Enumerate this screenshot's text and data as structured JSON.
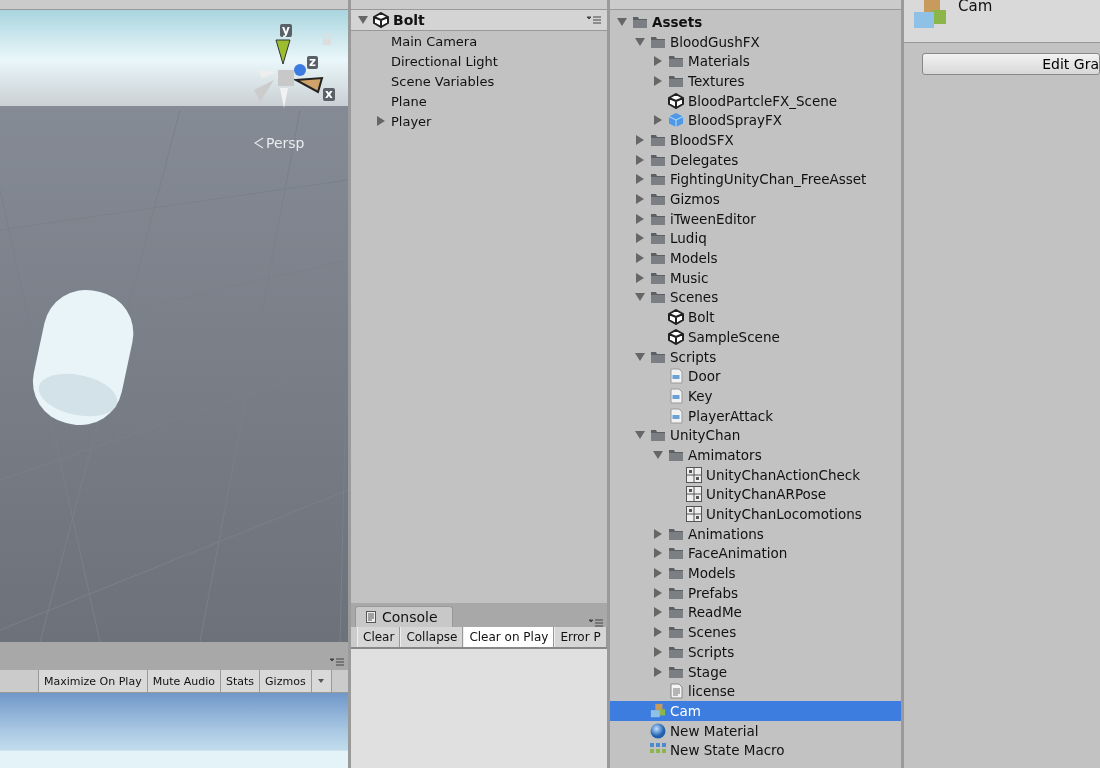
{
  "scene_view": {
    "axes": {
      "y": "y",
      "z": "z",
      "x": "x"
    },
    "projection": "Persp"
  },
  "game_view": {
    "toolbar": [
      {
        "label": "Maximize On Play",
        "selected": false
      },
      {
        "label": "Mute Audio",
        "selected": false
      },
      {
        "label": "Stats",
        "selected": false
      },
      {
        "label": "Gizmos",
        "selected": false
      }
    ]
  },
  "hierarchy": {
    "scene": {
      "label": "Bolt",
      "expanded": true
    },
    "items": [
      {
        "label": "Main Camera"
      },
      {
        "label": "Directional Light"
      },
      {
        "label": "Scene Variables"
      },
      {
        "label": "Plane"
      },
      {
        "label": "Player",
        "expanded": false
      }
    ]
  },
  "console": {
    "tab": "Console",
    "buttons": [
      {
        "label": "Clear",
        "kind": "button"
      },
      {
        "label": "Collapse",
        "kind": "toggle",
        "selected": false
      },
      {
        "label": "Clear on Play",
        "kind": "toggle",
        "selected": true
      },
      {
        "label": "Error P",
        "kind": "toggle",
        "selected": false
      }
    ]
  },
  "project": {
    "items": [
      {
        "label": "Assets",
        "kind": "folder",
        "expanded": true,
        "selected": false,
        "children": [
          {
            "label": "BloodGushFX",
            "kind": "folder",
            "expanded": true,
            "selected": false,
            "children": [
              {
                "label": "Materials",
                "kind": "folder",
                "expanded": false,
                "selected": false
              },
              {
                "label": "Textures",
                "kind": "folder",
                "expanded": false,
                "selected": false
              },
              {
                "label": "BloodPartcleFX_Scene",
                "kind": "scene",
                "selected": false
              },
              {
                "label": "BloodSprayFX",
                "kind": "cube",
                "expanded": false,
                "selected": false
              }
            ]
          },
          {
            "label": "BloodSFX",
            "kind": "folder",
            "expanded": false,
            "selected": false
          },
          {
            "label": "Delegates",
            "kind": "folder",
            "expanded": false,
            "selected": false
          },
          {
            "label": "FightingUnityChan_FreeAsset",
            "kind": "folder",
            "expanded": false,
            "selected": false
          },
          {
            "label": "Gizmos",
            "kind": "folder",
            "expanded": false,
            "selected": false
          },
          {
            "label": "iTweenEditor",
            "kind": "folder",
            "expanded": false,
            "selected": false
          },
          {
            "label": "Ludiq",
            "kind": "folder",
            "expanded": false,
            "selected": false
          },
          {
            "label": "Models",
            "kind": "folder",
            "expanded": false,
            "selected": false
          },
          {
            "label": "Music",
            "kind": "folder",
            "expanded": false,
            "selected": false
          },
          {
            "label": "Scenes",
            "kind": "folder",
            "expanded": true,
            "selected": false,
            "children": [
              {
                "label": "Bolt",
                "kind": "scene",
                "selected": false
              },
              {
                "label": "SampleScene",
                "kind": "scene",
                "selected": false
              }
            ]
          },
          {
            "label": "Scripts",
            "kind": "folder",
            "expanded": true,
            "selected": false,
            "children": [
              {
                "label": "Door",
                "kind": "script",
                "selected": false
              },
              {
                "label": "Key",
                "kind": "script",
                "selected": false
              },
              {
                "label": "PlayerAttack",
                "kind": "script",
                "selected": false
              }
            ]
          },
          {
            "label": "UnityChan",
            "kind": "folder",
            "expanded": true,
            "selected": false,
            "children": [
              {
                "label": "Amimators",
                "kind": "folder",
                "expanded": true,
                "selected": false,
                "children": [
                  {
                    "label": "UnityChanActionCheck",
                    "kind": "animator",
                    "selected": false
                  },
                  {
                    "label": "UnityChanARPose",
                    "kind": "animator",
                    "selected": false
                  },
                  {
                    "label": "UnityChanLocomotions",
                    "kind": "animator",
                    "selected": false
                  }
                ]
              },
              {
                "label": "Animations",
                "kind": "folder",
                "expanded": false,
                "selected": false
              },
              {
                "label": "FaceAnimation",
                "kind": "folder",
                "expanded": false,
                "selected": false
              },
              {
                "label": "Models",
                "kind": "folder",
                "expanded": false,
                "selected": false
              },
              {
                "label": "Prefabs",
                "kind": "folder",
                "expanded": false,
                "selected": false
              },
              {
                "label": "ReadMe",
                "kind": "folder",
                "expanded": false,
                "selected": false
              },
              {
                "label": "Scenes",
                "kind": "folder",
                "expanded": false,
                "selected": false
              },
              {
                "label": "Scripts",
                "kind": "folder",
                "expanded": false,
                "selected": false
              },
              {
                "label": "Stage",
                "kind": "folder",
                "expanded": false,
                "selected": false
              },
              {
                "label": "license",
                "kind": "text",
                "selected": false
              }
            ]
          },
          {
            "label": "Cam",
            "kind": "prefab",
            "selected": true
          },
          {
            "label": "New Material",
            "kind": "material",
            "selected": false
          },
          {
            "label": "New State Macro",
            "kind": "macro",
            "selected": false
          }
        ]
      }
    ]
  },
  "inspector": {
    "title": "Cam",
    "button": "Edit Gra"
  }
}
